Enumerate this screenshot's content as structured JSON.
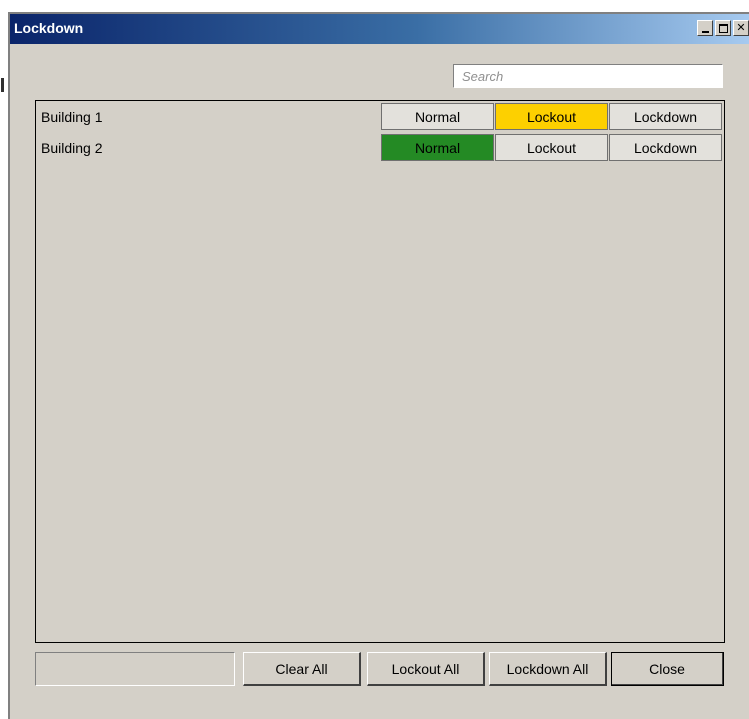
{
  "window": {
    "title": "Lockdown",
    "controls": [
      "minimize",
      "maximize",
      "close"
    ]
  },
  "search": {
    "placeholder": "Search",
    "value": ""
  },
  "buildings": [
    {
      "name": "Building 1",
      "states": [
        "Normal",
        "Lockout",
        "Lockdown"
      ],
      "active": "Lockout"
    },
    {
      "name": "Building 2",
      "states": [
        "Normal",
        "Lockout",
        "Lockdown"
      ],
      "active": "Normal"
    }
  ],
  "footer": {
    "status_text": "",
    "clear_all": "Clear All",
    "lockout_all": "Lockout All",
    "lockdown_all": "Lockdown All",
    "close": "Close"
  },
  "colors": {
    "lockout_active": "#fdd000",
    "normal_active": "#248a24",
    "titlebar_start": "#0a246a",
    "titlebar_end": "#a6caf0",
    "window_bg": "#d4d0c8"
  }
}
